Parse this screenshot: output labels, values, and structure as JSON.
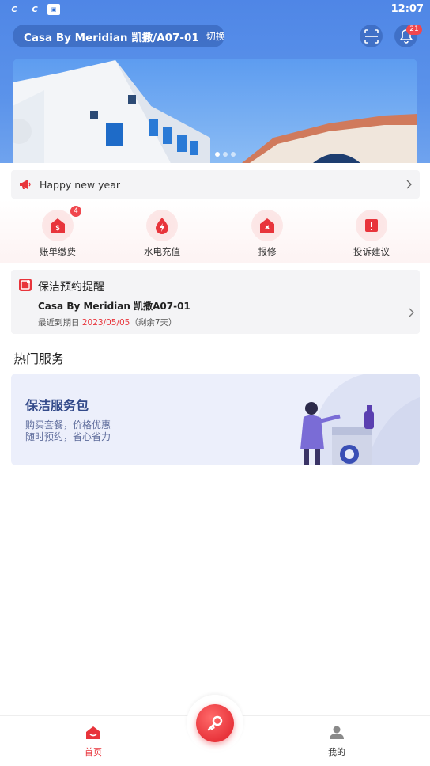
{
  "status_bar": {
    "time": "12:07",
    "icons": [
      "app-notification-icon",
      "app-notification-icon",
      "app-badge-icon"
    ]
  },
  "header": {
    "location_name": "Casa By Meridian 凯撒/A07-01",
    "switch_label": "切换",
    "notification_count": "21"
  },
  "banner": {
    "dot_count": 3,
    "active_dot": 0
  },
  "notice": {
    "text": "Happy new year"
  },
  "quick_actions": [
    {
      "label": "账单缴费",
      "icon": "bill-icon",
      "badge": "4"
    },
    {
      "label": "水电充值",
      "icon": "utility-icon",
      "badge": ""
    },
    {
      "label": "报修",
      "icon": "repair-icon",
      "badge": ""
    },
    {
      "label": "投诉建议",
      "icon": "complaint-icon",
      "badge": ""
    }
  ],
  "reminder": {
    "title": "保洁预约提醒",
    "place": "Casa By Meridian 凯撒A07-01",
    "due_prefix": "最近到期日",
    "due_date": "2023/05/05",
    "remaining": "（剩余7天）"
  },
  "hot_services": {
    "title": "热门服务",
    "card": {
      "title": "保洁服务包",
      "line1": "购买套餐，价格优惠",
      "line2": "随时预约，省心省力"
    }
  },
  "bottom_nav": {
    "home_label": "首页",
    "mine_label": "我的"
  },
  "colors": {
    "accent_red": "#e8343b",
    "header_blue": "#5b93ea",
    "service_card_bg": "#eceffb"
  }
}
